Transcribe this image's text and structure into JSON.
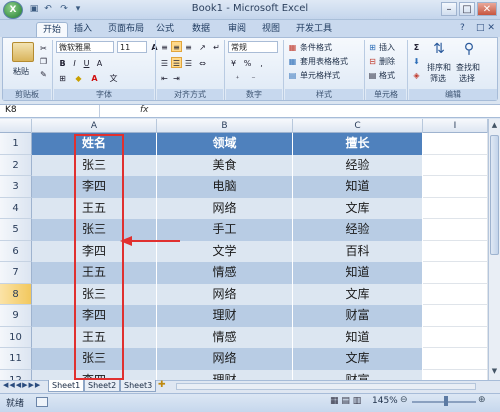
{
  "window": {
    "title": "Book1 - Microsoft Excel",
    "orb": "X"
  },
  "tabs": [
    "开始",
    "插入",
    "页面布局",
    "公式",
    "数据",
    "审阅",
    "视图",
    "开发工具"
  ],
  "ribbon": {
    "paste": "粘贴",
    "font_name": "微软雅黑",
    "font_size": "11",
    "number_format": "常规",
    "styles": [
      "条件格式",
      "套用表格格式",
      "单元格样式"
    ],
    "cells": [
      "插入",
      "删除",
      "格式"
    ],
    "edit": [
      "排序和",
      "筛选",
      "查找和",
      "选择"
    ],
    "groups": [
      "剪贴板",
      "字体",
      "对齐方式",
      "数字",
      "样式",
      "单元格",
      "编辑"
    ]
  },
  "formula_bar": {
    "name_box": "K8",
    "fx": "fx"
  },
  "columns": [
    "A",
    "B",
    "C",
    "I"
  ],
  "rows": [
    "1",
    "2",
    "3",
    "4",
    "5",
    "6",
    "7",
    "8",
    "9",
    "10",
    "11",
    "12"
  ],
  "table": {
    "headers": [
      "姓名",
      "领域",
      "擅长"
    ],
    "data": [
      [
        "张三",
        "美食",
        "经验"
      ],
      [
        "李四",
        "电脑",
        "知道"
      ],
      [
        "王五",
        "网络",
        "文库"
      ],
      [
        "张三",
        "手工",
        "经验"
      ],
      [
        "李四",
        "文学",
        "百科"
      ],
      [
        "王五",
        "情感",
        "知道"
      ],
      [
        "张三",
        "网络",
        "文库"
      ],
      [
        "李四",
        "理财",
        "财富"
      ],
      [
        "王五",
        "情感",
        "知道"
      ],
      [
        "张三",
        "网络",
        "文库"
      ],
      [
        "李四",
        "理财",
        "财富"
      ]
    ]
  },
  "sheets": [
    "Sheet1",
    "Sheet2",
    "Sheet3"
  ],
  "status": {
    "ready": "就绪",
    "zoom": "145%"
  },
  "colors": {
    "header": "#4f81bd",
    "band_light": "#dce6f1",
    "band_dark": "#b8cce4",
    "annotation": "#e0302f"
  }
}
